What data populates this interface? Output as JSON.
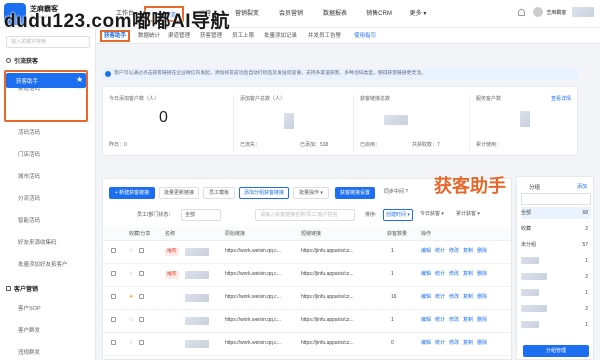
{
  "watermark": "dudu123.com嘟嘟AI导航",
  "brand": {
    "name": "芝麻霸客",
    "sub": "ZHIMAKE"
  },
  "topnav": [
    {
      "label": "工作台"
    },
    {
      "label": "获客引流"
    },
    {
      "label": "运营"
    },
    {
      "label": "营销裂变"
    },
    {
      "label": "会员营销"
    },
    {
      "label": "数据报表"
    },
    {
      "label": "销售CRM"
    },
    {
      "label": "更多 ▾"
    }
  ],
  "user": {
    "name": "芝麻霸客"
  },
  "subtabs": [
    {
      "label": "获客助手"
    },
    {
      "label": "数据统计"
    },
    {
      "label": "渠道管理"
    },
    {
      "label": "获客管理"
    },
    {
      "label": "员工上限"
    },
    {
      "label": "批量添加记录"
    },
    {
      "label": "并发员工告警"
    },
    {
      "label": "使用指引"
    }
  ],
  "sidebar": {
    "search_placeholder": "输入关键字搜索",
    "groups": [
      {
        "label": "引流获客",
        "items": [
          "渠道活码",
          "获客助手",
          "活码活码",
          "门店活码",
          "城市活码",
          "分流活码",
          "智能活码",
          "好友来源收集码",
          "批量添加好友拓客户"
        ]
      },
      {
        "label": "客户营销",
        "items": [
          "客户SOP",
          "客户群发",
          "违规群发"
        ]
      }
    ]
  },
  "notice": "客户可以通过点击获客链接在企业微信内发起，添加好友成功后自动打标签及发送欢迎语，支持多渠道获客，多种活码类型，使得获客链接更灵活。",
  "stats": [
    {
      "label": "今日添加客户数（人）",
      "value": "0",
      "foot": "昨日：0"
    },
    {
      "label": "添加客户总数（人）",
      "value": "",
      "foot": "已流失：",
      "foot2": "已添加：538"
    },
    {
      "label": "获客链接总数",
      "value": "",
      "foot": "已启用：",
      "foot2": "共获取数：7"
    },
    {
      "label": "服务客户数",
      "value": "",
      "foot": "累计使用：",
      "link": "查看详情"
    }
  ],
  "toolbar": {
    "new_btn": "+ 新建获客链接",
    "btn2": "批量更新链接",
    "btn3": "员工模板",
    "btn4": "添加分组获客链接",
    "btn5": "批量操作 ▾",
    "btn6": "获客链接设置",
    "btn7": "同步中间 ?",
    "filter_label": "员工/部门状态：",
    "filter_value": "全部",
    "search_placeholder": "请输入获客链接名称/员工/客户姓名",
    "sort_label": "排序:",
    "sort1": "创建时间 ▾",
    "sort2": "今日获客 ▾",
    "sort3": "累计获客 ▾"
  },
  "big_label": "获客助手",
  "table": {
    "headers": [
      "",
      "收藏/分享",
      "名称",
      "原始链接",
      "短链链接",
      "获客数量",
      "操作"
    ],
    "rows": [
      {
        "tag": "推荐",
        "url1": "https://work.weixin.qq.c...",
        "url2": "https://jinfu.apparis/cz...",
        "count": "1",
        "star": false
      },
      {
        "tag": "推荐",
        "url1": "https://work.weixin.qq.c...",
        "url2": "https://jinfu.apparis/cz...",
        "count": "1",
        "star": false
      },
      {
        "tag": "",
        "url1": "https://work.weixin.qq.c...",
        "url2": "https://jinfu.apparis/cz...",
        "count": "16",
        "star": true
      },
      {
        "tag": "",
        "url1": "https://work.weixin.qq.c...",
        "url2": "https://jinfu.apparis/cz...",
        "count": "1",
        "star": false
      },
      {
        "tag": "",
        "url1": "https://work.weixin.qq.c...",
        "url2": "https://jinfu.apparis/cz...",
        "count": "0",
        "star": false
      }
    ],
    "ops": [
      "编辑",
      "统计",
      "修改",
      "复制",
      "删除"
    ]
  },
  "rightpanel": {
    "title": "分组",
    "btn": "添加",
    "items": [
      {
        "label": "全部",
        "count": "68"
      },
      {
        "label": "收藏",
        "count": "2"
      },
      {
        "label": "未分组",
        "count": "57"
      },
      {
        "label": "",
        "count": "1"
      },
      {
        "label": "",
        "count": "2"
      },
      {
        "label": "",
        "count": "1"
      },
      {
        "label": "",
        "count": "2"
      },
      {
        "label": "",
        "count": "1"
      }
    ],
    "manage_btn": "分组管理"
  },
  "colors": {
    "accent": "#1d6ff2",
    "highlight": "#e8682c"
  }
}
